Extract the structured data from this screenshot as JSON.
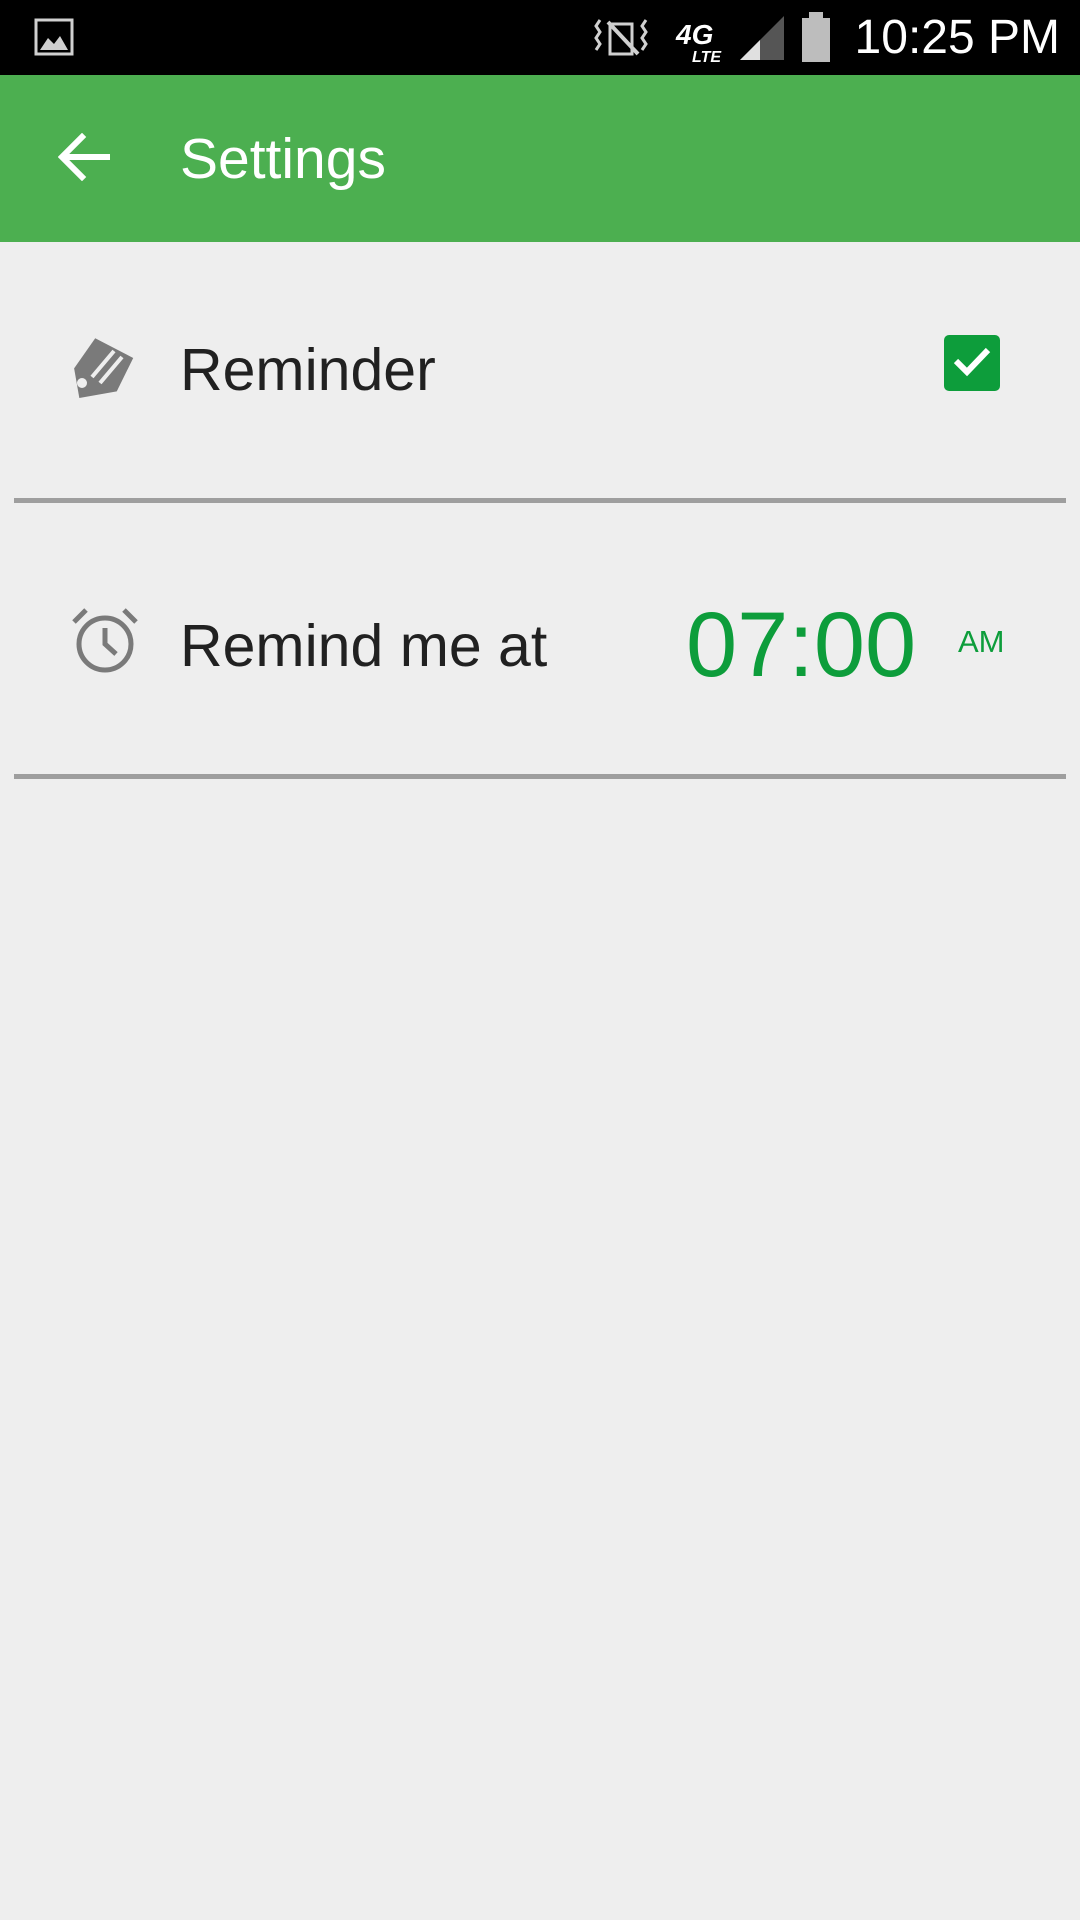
{
  "status_bar": {
    "time": "10:25 PM",
    "icons": [
      "gallery-icon",
      "vibrate-icon",
      "4g-lte-icon",
      "signal-icon",
      "battery-icon"
    ]
  },
  "app_bar": {
    "title": "Settings",
    "background_color": "#4caf50",
    "back_icon": "arrow-back-icon"
  },
  "settings": {
    "reminder": {
      "icon": "tag-icon",
      "label": "Reminder",
      "checked": true
    },
    "remind_time": {
      "icon": "alarm-clock-icon",
      "label": "Remind me at",
      "time": "07:00",
      "period": "AM"
    }
  },
  "colors": {
    "accent": "#0d9d3b",
    "divider": "#9e9e9e",
    "background": "#eeeeee"
  }
}
